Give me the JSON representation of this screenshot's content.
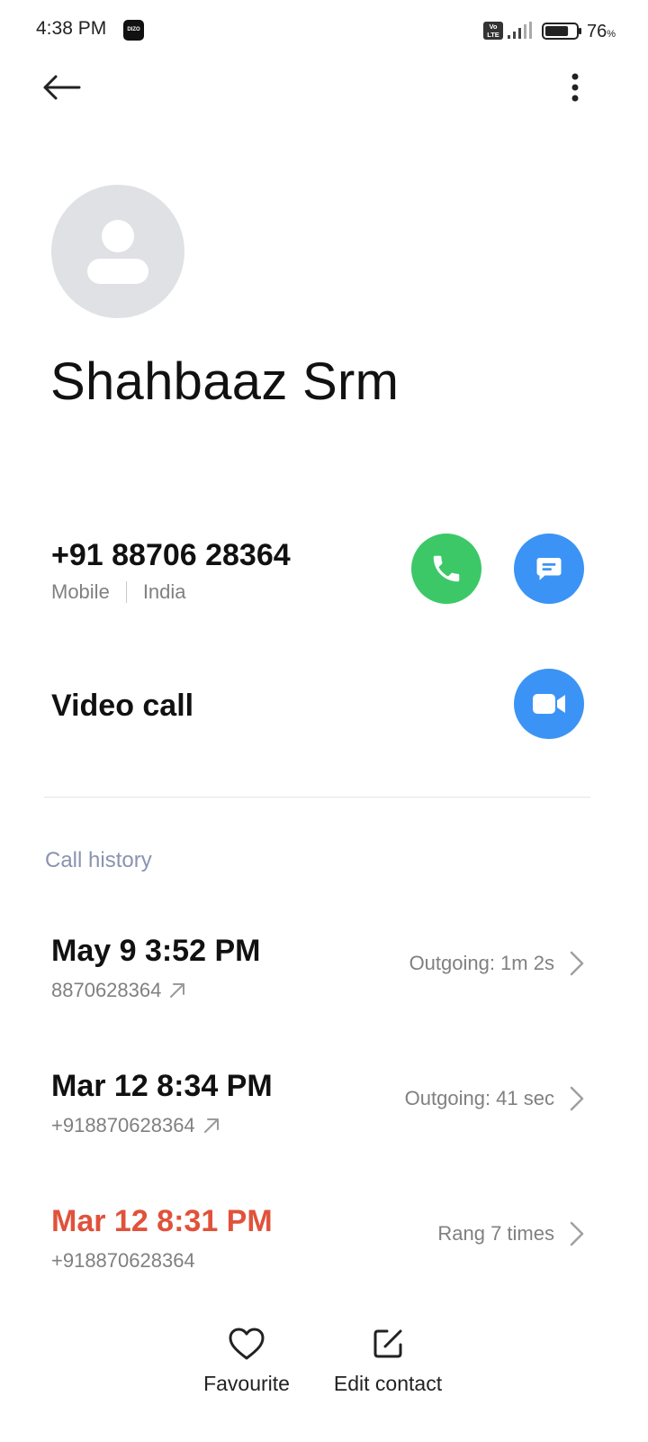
{
  "status_bar": {
    "time": "4:38 PM",
    "brand_badge": "DIZO",
    "volte": "Vo LTE",
    "battery_percent": "76",
    "battery_unit": "%",
    "battery_level": 0.76
  },
  "contact": {
    "name": "Shahbaaz Srm",
    "phone_number": "+91 88706 28364",
    "phone_type": "Mobile",
    "phone_region": "India",
    "video_call_label": "Video call"
  },
  "call_history": {
    "title": "Call history",
    "entries": [
      {
        "date": "May 9 3:52 PM",
        "number": "8870628364",
        "direction": "outgoing",
        "status": "Outgoing: 1m 2s",
        "missed": false
      },
      {
        "date": "Mar 12 8:34 PM",
        "number": "+918870628364",
        "direction": "outgoing",
        "status": "Outgoing: 41 sec",
        "missed": false
      },
      {
        "date": "Mar 12 8:31 PM",
        "number": "+918870628364",
        "direction": "missed",
        "status": "Rang 7 times",
        "missed": true
      }
    ]
  },
  "bottom_actions": {
    "favourite_label": "Favourite",
    "edit_label": "Edit contact"
  },
  "colors": {
    "call_green": "#3cc867",
    "action_blue": "#3b93f5",
    "missed_red": "#e0523b",
    "section_title": "#8a93b0",
    "avatar_bg": "#dfe1e5"
  },
  "icons": {
    "back": "back-arrow-icon",
    "more": "more-vertical-icon",
    "call": "phone-icon",
    "message": "message-icon",
    "video": "video-camera-icon",
    "outgoing": "outgoing-arrow-icon",
    "chevron": "chevron-right-icon",
    "favourite": "heart-icon",
    "edit": "edit-icon"
  }
}
